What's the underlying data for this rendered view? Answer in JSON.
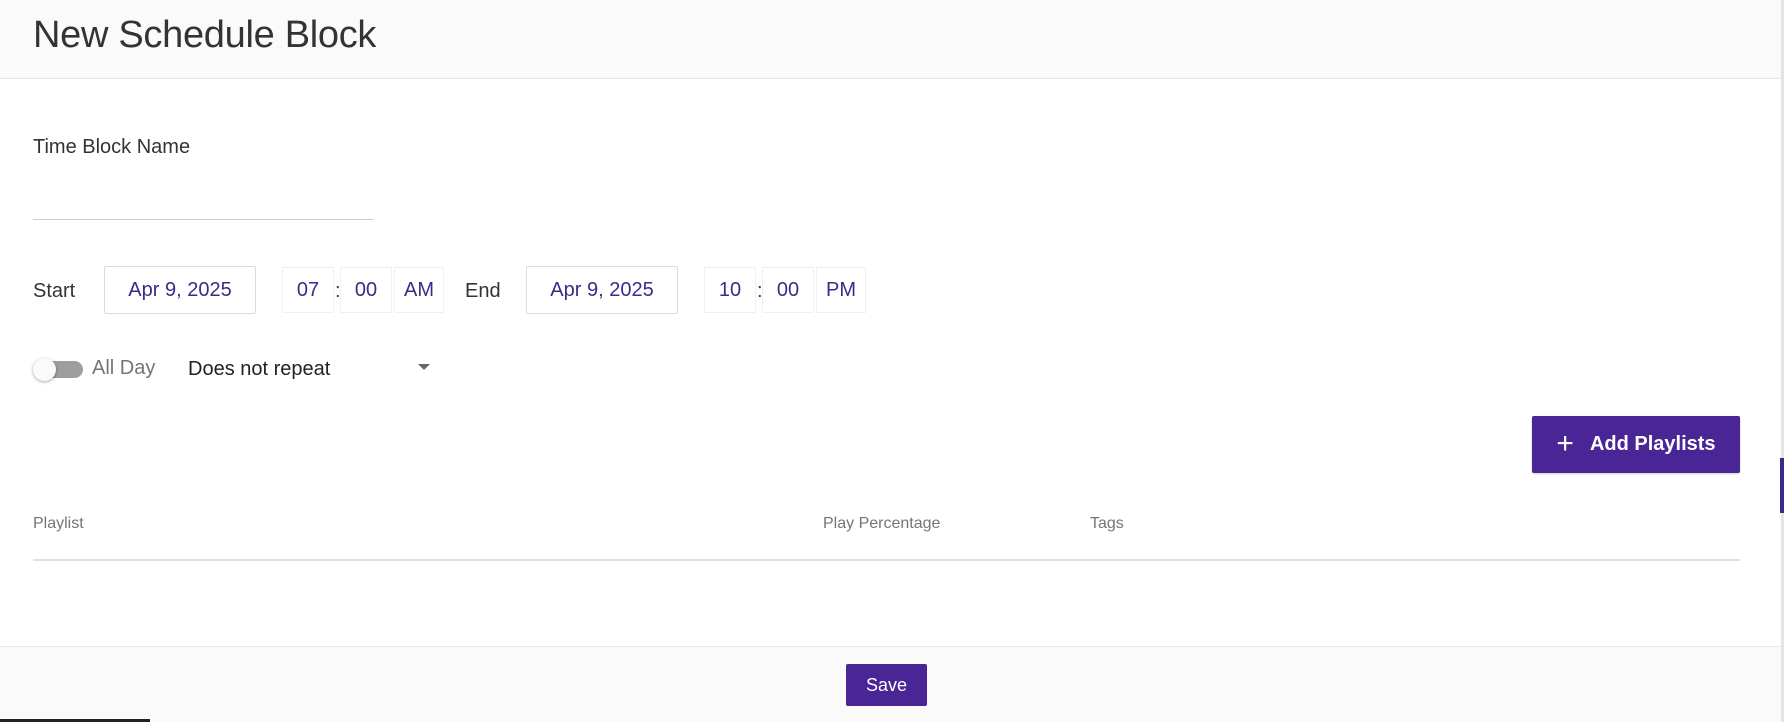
{
  "header": {
    "title": "New Schedule Block"
  },
  "form": {
    "name_label": "Time Block Name",
    "name_value": "",
    "start": {
      "label": "Start",
      "date": "Apr 9, 2025",
      "hour": "07",
      "minute": "00",
      "separator": ":",
      "meridiem": "AM"
    },
    "end": {
      "label": "End",
      "date": "Apr 9, 2025",
      "hour": "10",
      "minute": "00",
      "separator": ":",
      "meridiem": "PM"
    },
    "all_day": {
      "label": "All Day",
      "checked": false
    },
    "repeat": {
      "selected": "Does not repeat"
    }
  },
  "playlists": {
    "add_button_label": "Add Playlists",
    "add_button_icon": "plus-icon",
    "columns": [
      "Playlist",
      "Play Percentage",
      "Tags"
    ],
    "rows": []
  },
  "footer": {
    "save_label": "Save"
  },
  "colors": {
    "accent": "#4a2596",
    "value_text": "#3d2a86",
    "header_bg": "#fafafa"
  }
}
